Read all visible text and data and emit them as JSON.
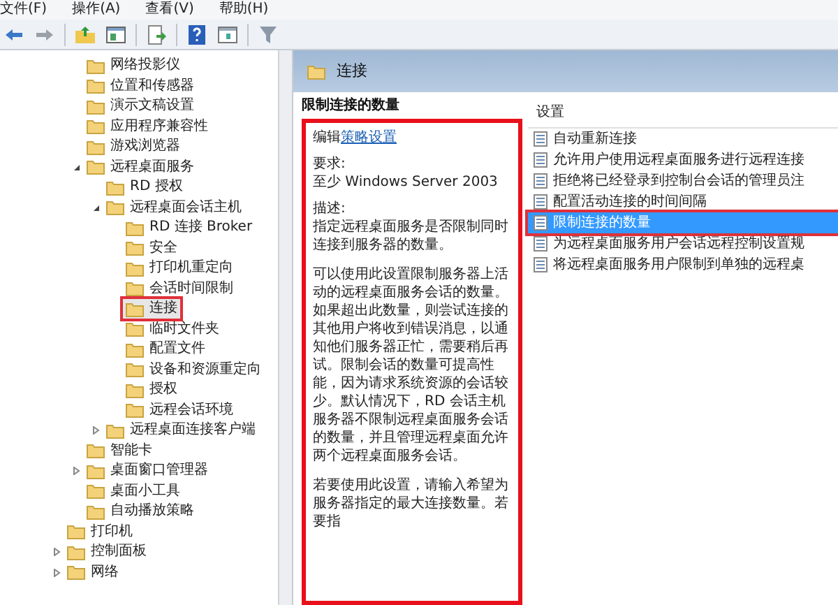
{
  "menu_bar": [
    "文件(F)",
    "操作(A)",
    "查看(V)",
    "帮助(H)"
  ],
  "tree": {
    "continued_items": [
      {
        "label": "网络投影仪",
        "selected": false,
        "highlighted": false
      },
      {
        "label": "位置和传感器",
        "selected": false,
        "highlighted": false
      },
      {
        "label": "演示文稿设置",
        "selected": false,
        "highlighted": false
      },
      {
        "label": "应用程序兼容性",
        "selected": false,
        "highlighted": false
      },
      {
        "label": "游戏浏览器",
        "selected": false,
        "highlighted": false
      },
      {
        "label": "远程桌面服务",
        "selected": false,
        "highlighted": false,
        "expanded": true,
        "children": [
          {
            "label": "RD 授权",
            "selected": false,
            "highlighted": false
          },
          {
            "label": "远程桌面会话主机",
            "selected": false,
            "highlighted": false,
            "expanded": true,
            "children": [
              {
                "label": "RD 连接 Broker",
                "selected": false,
                "highlighted": false
              },
              {
                "label": "安全",
                "selected": false,
                "highlighted": false
              },
              {
                "label": "打印机重定向",
                "selected": false,
                "highlighted": false
              },
              {
                "label": "会话时间限制",
                "selected": false,
                "highlighted": false
              },
              {
                "label": "连接",
                "selected": true,
                "highlighted": true
              },
              {
                "label": "临时文件夹",
                "selected": false,
                "highlighted": false
              },
              {
                "label": "配置文件",
                "selected": false,
                "highlighted": false
              },
              {
                "label": "设备和资源重定向",
                "selected": false,
                "highlighted": false
              },
              {
                "label": "授权",
                "selected": false,
                "highlighted": false
              },
              {
                "label": "远程会话环境",
                "selected": false,
                "highlighted": false
              }
            ]
          },
          {
            "label": "远程桌面连接客户端",
            "selected": false,
            "highlighted": false,
            "expanded": false
          }
        ]
      },
      {
        "label": "智能卡",
        "selected": false,
        "highlighted": false
      },
      {
        "label": "桌面窗口管理器",
        "selected": false,
        "highlighted": false,
        "expanded": false
      },
      {
        "label": "桌面小工具",
        "selected": false,
        "highlighted": false
      },
      {
        "label": "自动播放策略",
        "selected": false,
        "highlighted": false
      }
    ],
    "items": [
      {
        "label": "打印机",
        "selected": false,
        "highlighted": false
      },
      {
        "label": "控制面板",
        "selected": false,
        "highlighted": false,
        "expanded": false
      },
      {
        "label": "网络",
        "selected": false,
        "highlighted": false,
        "expanded": false
      }
    ]
  },
  "header": {
    "title": "连接"
  },
  "description": {
    "title": "限制连接的数量",
    "highlighted": true,
    "edit_prefix": "编辑",
    "edit_link": "策略设置",
    "requirements_label": "要求:",
    "requirements": "至少 Windows Server 2003",
    "description_label": "描述:",
    "paragraphs": [
      "指定远程桌面服务是否限制同时连接到服务器的数量。",
      "可以使用此设置限制服务器上活动的远程桌面服务会话的数量。如果超出此数量，则尝试连接的其他用户将收到错误消息，以通知他们服务器正忙，需要稍后再试。限制会话的数量可提高性能，因为请求系统资源的会话较少。默认情况下，RD 会话主机服务器不限制远程桌面服务会话的数量，并且管理远程桌面允许两个远程桌面服务会话。",
      "若要使用此设置，请输入希望为服务器指定的最大连接数量。若要指"
    ]
  },
  "settings": {
    "column": "设置",
    "items": [
      {
        "label": "自动重新连接",
        "selected": false,
        "highlighted": false
      },
      {
        "label": "允许用户使用远程桌面服务进行远程连接",
        "selected": false,
        "highlighted": false
      },
      {
        "label": "拒绝将已经登录到控制台会话的管理员注",
        "selected": false,
        "highlighted": false
      },
      {
        "label": "配置活动连接的时间间隔",
        "selected": false,
        "highlighted": false
      },
      {
        "label": "限制连接的数量",
        "selected": true,
        "highlighted": true
      },
      {
        "label": "为远程桌面服务用户会话远程控制设置规",
        "selected": false,
        "highlighted": false
      },
      {
        "label": "将远程桌面服务用户限制到单独的远程桌",
        "selected": false,
        "highlighted": false
      }
    ]
  }
}
